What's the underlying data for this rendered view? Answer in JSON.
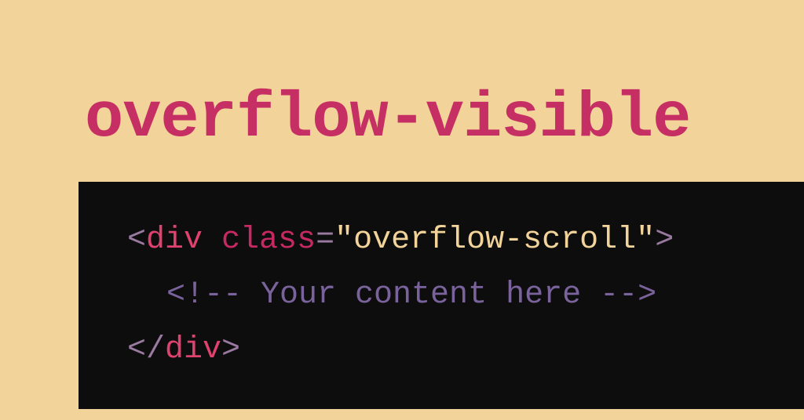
{
  "heading": "overflow-visible",
  "code": {
    "line1": {
      "open_bracket": "<",
      "tag": "div",
      "space1": " ",
      "attr_name": "class",
      "equals": "=",
      "quote_open": "\"",
      "attr_value": "overflow-scroll",
      "quote_close": "\"",
      "close_bracket": ">"
    },
    "line2": {
      "comment": "<!-- Your content here -->"
    },
    "line3": {
      "open_bracket": "<",
      "slash": "/",
      "tag": "div",
      "close_bracket": ">"
    }
  }
}
